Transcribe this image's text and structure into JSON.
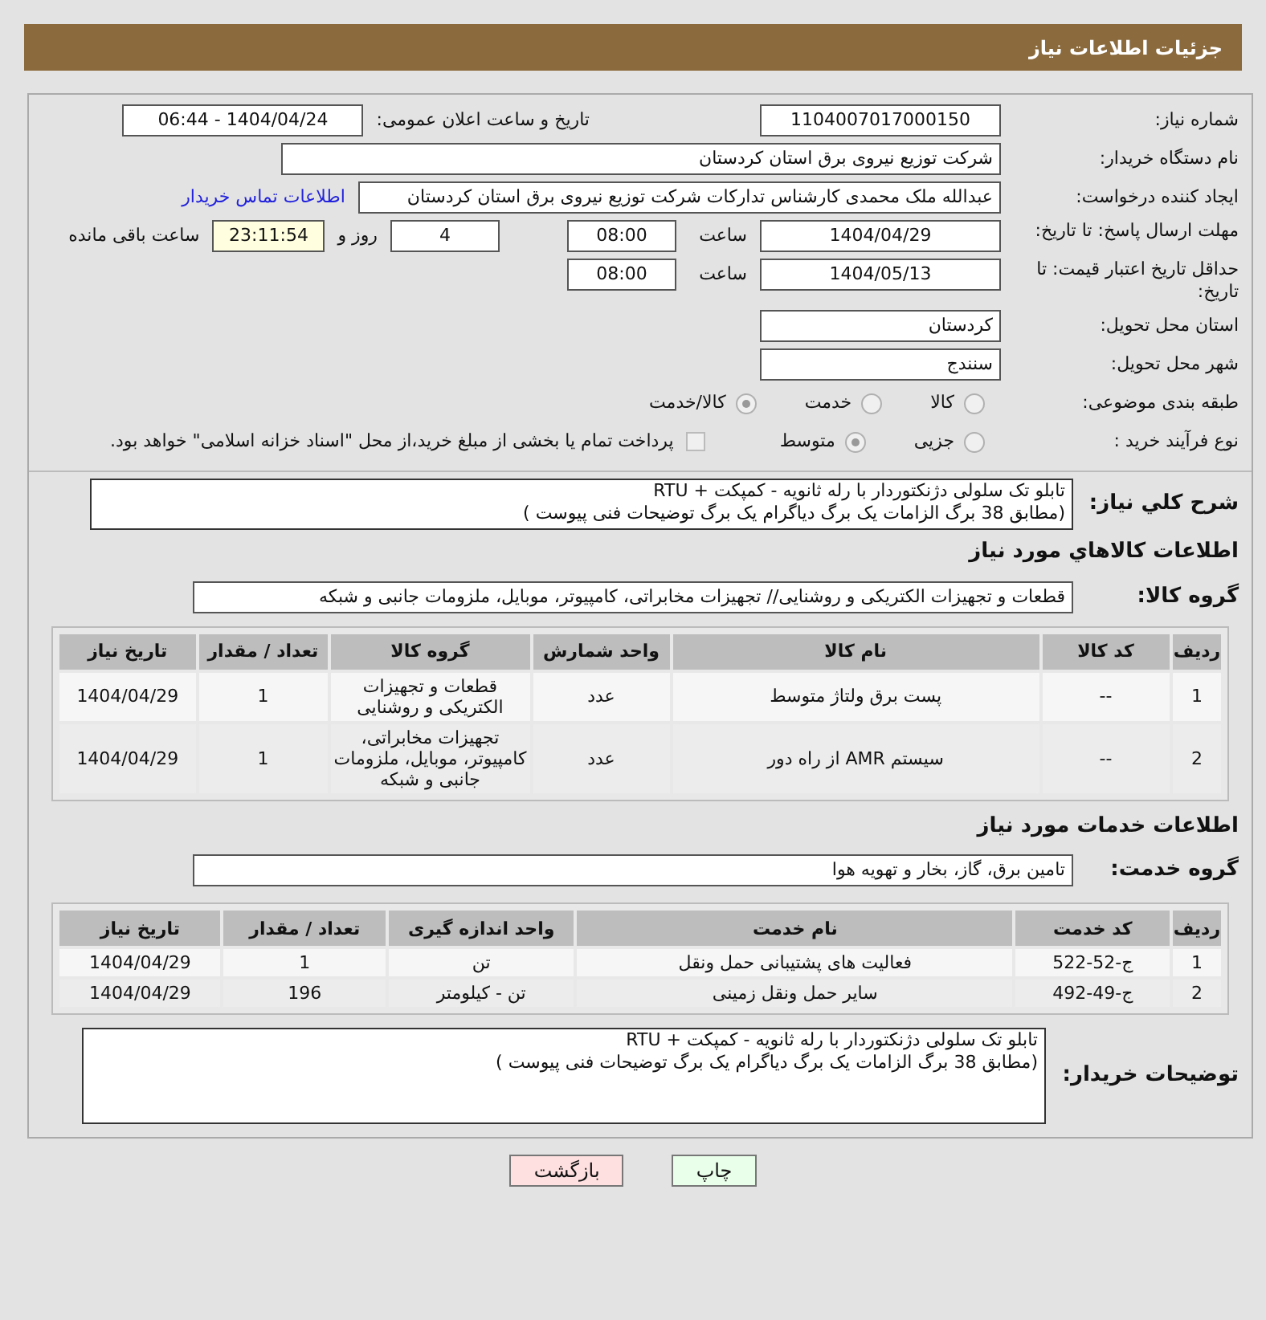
{
  "header": {
    "title": "جزئیات اطلاعات نیاز"
  },
  "need_number": {
    "label": "شماره نیاز:",
    "value": "1104007017000150"
  },
  "announce": {
    "label": "تاریخ و ساعت اعلان عمومی:",
    "value": "1404/04/24 - 06:44"
  },
  "buyer": {
    "label": "نام دستگاه خریدار:",
    "value": "شرکت توزیع نیروی برق استان کردستان"
  },
  "requester": {
    "label": "ایجاد کننده درخواست:",
    "value": "عبدالله ملک محمدی کارشناس تدارکات شرکت توزیع نیروی برق استان کردستان",
    "link": "اطلاعات تماس خریدار"
  },
  "deadline": {
    "label": "مهلت ارسال پاسخ: تا تاریخ:",
    "date": "1404/04/29",
    "time_label": "ساعت",
    "time": "08:00",
    "days": "4",
    "days_label": "روز و",
    "remaining": "23:11:54",
    "remaining_label": "ساعت باقی مانده"
  },
  "validity": {
    "label": "حداقل تاریخ اعتبار قیمت: تا تاریخ:",
    "date": "1404/05/13",
    "time_label": "ساعت",
    "time": "08:00"
  },
  "province": {
    "label": "استان محل تحویل:",
    "value": "کردستان"
  },
  "city": {
    "label": "شهر محل تحویل:",
    "value": "سنندج"
  },
  "category": {
    "label": "طبقه بندی موضوعی:",
    "options": [
      {
        "label": "کالا",
        "selected": false
      },
      {
        "label": "خدمت",
        "selected": false
      },
      {
        "label": "کالا/خدمت",
        "selected": true
      }
    ]
  },
  "process": {
    "label": "نوع فرآیند خرید :",
    "options": [
      {
        "label": "جزیی",
        "selected": false
      },
      {
        "label": "متوسط",
        "selected": true
      }
    ],
    "payment": {
      "label": "پرداخت تمام یا بخشی از مبلغ خرید،از محل \"اسناد خزانه اسلامی\" خواهد بود.",
      "checked": false
    }
  },
  "summary": {
    "label": "شرح کلي نياز:",
    "value": "تابلو تک سلولی دژنکتوردار با رله ثانویه - کمپکت + RTU\n(مطابق 38 برگ الزامات یک برگ دیاگرام یک برگ توضیحات فنی پیوست )"
  },
  "goods": {
    "title": "اطلاعات كالاهاي مورد نياز",
    "group_label": "گروه کالا:",
    "group": "قطعات و تجهیزات الکتریکی و روشنایی// تجهیزات مخابراتی، کامپیوتر، موبایل، ملزومات جانبی و شبکه",
    "columns": [
      "ردیف",
      "کد کالا",
      "نام کالا",
      "واحد شمارش",
      "گروه کالا",
      "تعداد / مقدار",
      "تاریخ نیاز"
    ],
    "rows": [
      [
        "1",
        "--",
        "پست برق ولتاژ متوسط",
        "عدد",
        "قطعات و تجهیزات الکتریکی و روشنایی",
        "1",
        "1404/04/29"
      ],
      [
        "2",
        "--",
        "سیستم AMR از راه دور",
        "عدد",
        "تجهیزات مخابراتی، کامپیوتر، موبایل، ملزومات جانبی و شبکه",
        "1",
        "1404/04/29"
      ]
    ]
  },
  "services": {
    "title": "اطلاعات خدمات مورد نیاز",
    "group_label": "گروه خدمت:",
    "group": "تامین برق، گاز، بخار و تهویه هوا",
    "columns": [
      "ردیف",
      "کد خدمت",
      "نام خدمت",
      "واحد اندازه گیری",
      "تعداد / مقدار",
      "تاریخ نیاز"
    ],
    "rows": [
      [
        "1",
        "ج-52-522",
        "فعالیت های پشتیبانی حمل ونقل",
        "تن",
        "1",
        "1404/04/29"
      ],
      [
        "2",
        "ج-49-492",
        "سایر حمل ونقل زمینی",
        "تن - کیلومتر",
        "196",
        "1404/04/29"
      ]
    ]
  },
  "notes": {
    "label": "توضیحات خریدار:",
    "value": "تابلو تک سلولی دژنکتوردار با رله ثانویه - کمپکت + RTU\n(مطابق 38 برگ الزامات یک برگ دیاگرام یک برگ توضیحات فنی پیوست )"
  },
  "buttons": [
    {
      "label": "چاپ",
      "kind": "print"
    },
    {
      "label": "بازگشت",
      "kind": "back"
    }
  ]
}
